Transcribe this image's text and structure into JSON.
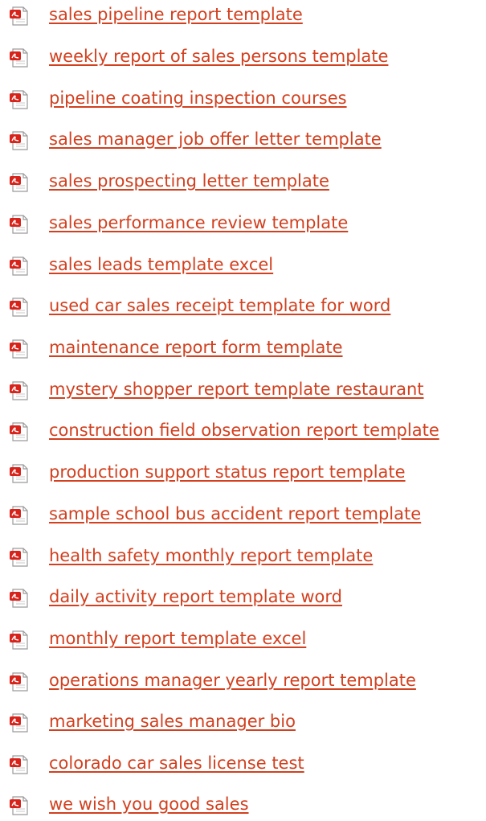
{
  "documents": [
    {
      "label": "sales pipeline report template",
      "icon": "pdf-file-icon"
    },
    {
      "label": "weekly report of sales persons template",
      "icon": "pdf-file-icon"
    },
    {
      "label": "pipeline coating inspection courses",
      "icon": "pdf-file-icon"
    },
    {
      "label": "sales manager job offer letter template",
      "icon": "pdf-file-icon"
    },
    {
      "label": "sales prospecting letter template",
      "icon": "pdf-file-icon"
    },
    {
      "label": "sales performance review template",
      "icon": "pdf-file-icon"
    },
    {
      "label": "sales leads template excel",
      "icon": "pdf-file-icon"
    },
    {
      "label": "used car sales receipt template for word",
      "icon": "pdf-file-icon"
    },
    {
      "label": "maintenance report form template",
      "icon": "pdf-file-icon"
    },
    {
      "label": "mystery shopper report template restaurant",
      "icon": "pdf-file-icon"
    },
    {
      "label": "construction field observation report template",
      "icon": "pdf-file-icon"
    },
    {
      "label": "production support status report template",
      "icon": "pdf-file-icon"
    },
    {
      "label": "sample school bus accident report template",
      "icon": "pdf-file-icon"
    },
    {
      "label": "health safety monthly report template",
      "icon": "pdf-file-icon"
    },
    {
      "label": "daily activity report template word",
      "icon": "pdf-file-icon"
    },
    {
      "label": "monthly report template excel",
      "icon": "pdf-file-icon"
    },
    {
      "label": "operations manager yearly report template",
      "icon": "pdf-file-icon"
    },
    {
      "label": "marketing sales manager bio",
      "icon": "pdf-file-icon"
    },
    {
      "label": "colorado car sales license test",
      "icon": "pdf-file-icon"
    },
    {
      "label": "we wish you good sales",
      "icon": "pdf-file-icon"
    }
  ],
  "colors": {
    "link": "#d2401f",
    "icon_red": "#d8231b",
    "icon_paper": "#ffffff",
    "icon_border": "#9a9a9a"
  }
}
